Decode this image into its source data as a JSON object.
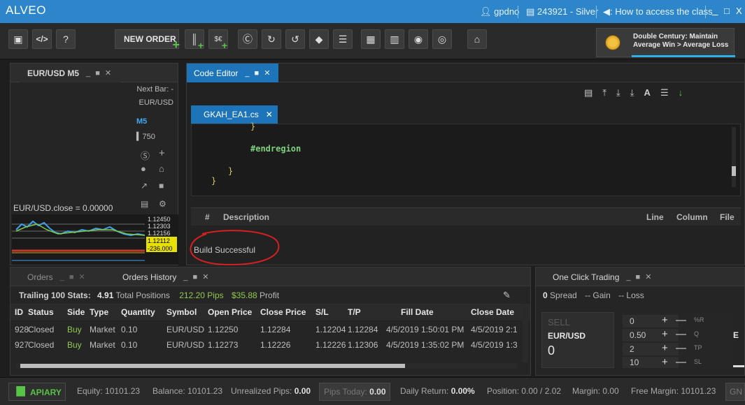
{
  "titlebar": {
    "app": "ALVEO",
    "user": "gpdno",
    "account": "243921 - Silver",
    "class_link": ": How to access the class",
    "minimize": "_",
    "maximize": "□",
    "close": "X"
  },
  "toolbar": {
    "new_order": "NEW ORDER",
    "promo_line1": "Double Century: Maintain",
    "promo_line2": "Average Win > Average Loss"
  },
  "chart": {
    "tab": "EUR/USD M5",
    "next_bar": "Next Bar: -",
    "symbol": "EUR/USD",
    "tf": "M5",
    "bars": "750",
    "close_label": "EUR/USD.close = 0.00000",
    "prices": [
      "1.12450",
      "1.12303",
      "1.12156",
      "1.12112",
      "-236.000"
    ]
  },
  "editor": {
    "tab": "Code Editor",
    "file_tab": "GKAH_EA1.cs",
    "lines": [
      "}",
      "#endregion",
      "}",
      "}"
    ],
    "output_cols": {
      "num": "#",
      "desc": "Description",
      "line": "Line",
      "column": "Column",
      "file": "File"
    },
    "build_msg": "Build Successful"
  },
  "orders": {
    "tab_orders": "Orders",
    "tab_history": "Orders History",
    "stats_label": "Trailing 100 Stats:",
    "total_positions": "4.91",
    "total_positions_label": "Total Positions",
    "pips": "212.20",
    "pips_label": "Pips",
    "profit": "$35.88",
    "profit_label": "Profit",
    "columns": [
      "ID",
      "Status",
      "Side",
      "Type",
      "Quantity",
      "Symbol",
      "Open Price",
      "Close Price",
      "S/L",
      "T/P",
      "Fill Date",
      "Close Date"
    ],
    "rows": [
      [
        "928",
        "Closed",
        "Buy",
        "Market",
        "0.10",
        "EUR/USD",
        "1.12250",
        "1.12284",
        "1.12204",
        "1.12284",
        "4/5/2019 1:50:01 PM",
        "4/5/2019 2:1"
      ],
      [
        "927",
        "Closed",
        "Buy",
        "Market",
        "0.10",
        "EUR/USD",
        "1.12273",
        "1.12226",
        "1.12226",
        "1.12306",
        "4/5/2019 1:35:02 PM",
        "4/5/2019 1:3"
      ]
    ]
  },
  "oneclick": {
    "tab": "One Click Trading",
    "spread_val": "0",
    "spread": "Spread",
    "gain": "-- Gain",
    "loss": "-- Loss",
    "sell": "SELL",
    "symbol": "EUR/USD",
    "sell_price": "0",
    "stepper_values": [
      "0",
      "0.50",
      "2",
      "10"
    ],
    "stepper_labels": [
      "%R",
      "Q",
      "TP",
      "SL"
    ],
    "right_letter": "E"
  },
  "status": {
    "apiary": "APIARY",
    "equity": "Equity: 10101.23",
    "balance": "Balance: 10101.23",
    "unrealized_label": "Unrealized Pips:",
    "unrealized_val": "0.00",
    "pips_today_label": "Pips Today:",
    "pips_today_val": "0.00",
    "daily_return_label": "Daily Return:",
    "daily_return_val": "0.00%",
    "position": "Position: 0.00 / 2.02",
    "margin": "Margin: 0.00",
    "free_margin": "Free Margin: 10101.23",
    "gn": "GN"
  },
  "colors": {
    "accent": "#2c86c9",
    "buy": "#8fc94e",
    "annotation": "#d42020"
  }
}
